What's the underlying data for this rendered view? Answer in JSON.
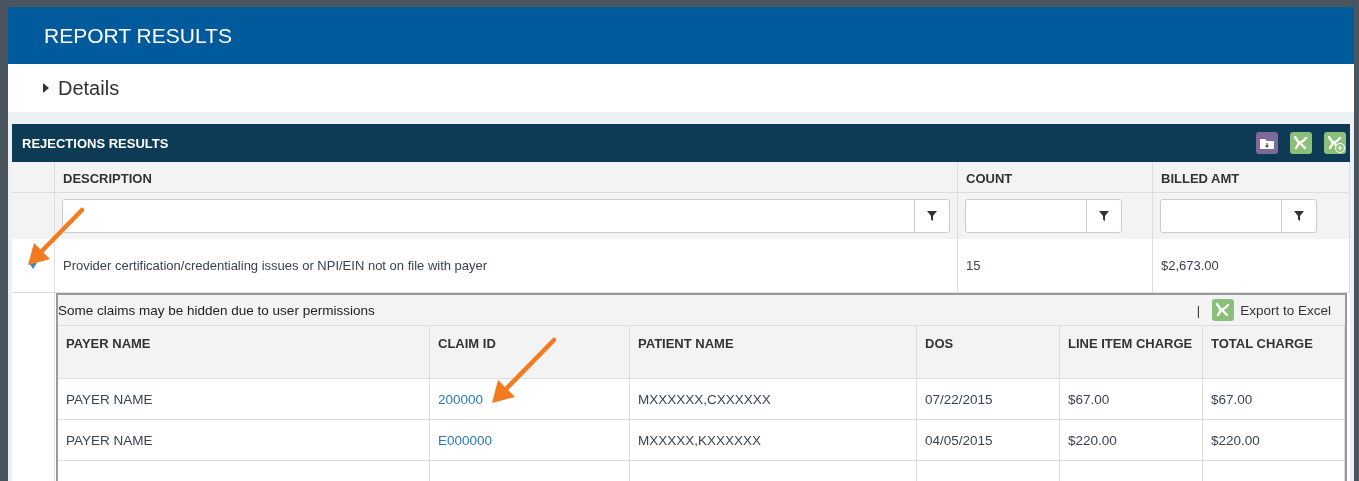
{
  "report": {
    "title": "REPORT RESULTS"
  },
  "details": {
    "label": "Details",
    "expanded": false
  },
  "panel": {
    "title": "REJECTIONS RESULTS"
  },
  "table": {
    "columns": [
      "DESCRIPTION",
      "COUNT",
      "BILLED AMT"
    ],
    "rows": [
      {
        "expanded": true,
        "description": "Provider certification/credentialing issues or NPI/EIN not on file with payer",
        "count": "15",
        "billed_amt": "$2,673.00",
        "claims": {
          "notice": "Some claims may be hidden due to user permissions",
          "separator": "|",
          "export_label": "Export to Excel",
          "columns": [
            "PAYER NAME",
            "CLAIM ID",
            "PATIENT NAME",
            "DOS",
            "LINE ITEM CHARGE",
            "TOTAL CHARGE"
          ],
          "rows": [
            {
              "payer_name": "PAYER NAME",
              "claim_id": "200000",
              "patient_name": "MXXXXXX,CXXXXXX",
              "dos": "07/22/2015",
              "line_item_charge": "$67.00",
              "total_charge": "$67.00"
            },
            {
              "payer_name": "PAYER NAME",
              "claim_id": "E000000",
              "patient_name": "MXXXXX,KXXXXXX",
              "dos": "04/05/2015",
              "line_item_charge": "$220.00",
              "total_charge": "$220.00"
            }
          ]
        }
      }
    ]
  }
}
